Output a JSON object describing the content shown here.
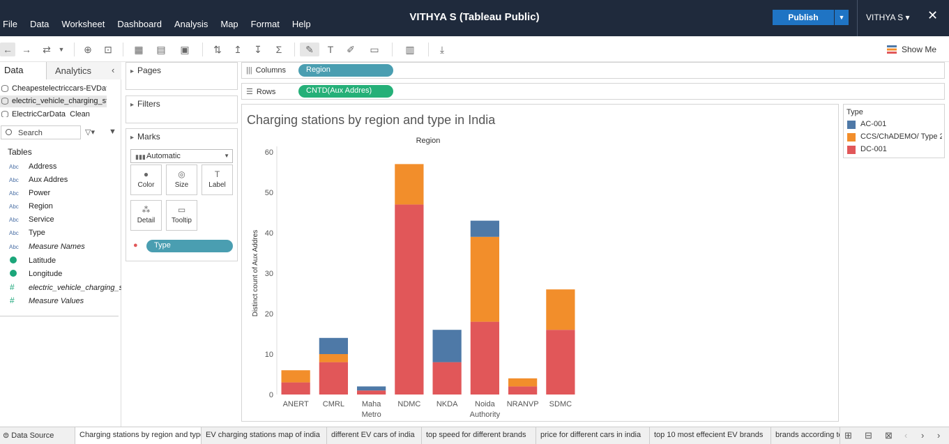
{
  "app": {
    "title": "VITHYA S (Tableau Public)",
    "menu": [
      "File",
      "Data",
      "Worksheet",
      "Dashboard",
      "Analysis",
      "Map",
      "Format",
      "Help"
    ],
    "publish_label": "Publish",
    "user_label": "VITHYA S ▾",
    "close_glyph": "✕"
  },
  "toolbar": {
    "show_me_label": "Show Me"
  },
  "data_pane": {
    "tabs": [
      "Data",
      "Analytics"
    ],
    "datasources": [
      "Cheapestelectriccars-EVDatabase",
      "electric_vehicle_charging_station_list",
      "ElectricCarData_Clean"
    ],
    "search_placeholder": "Search",
    "tables_heading": "Tables",
    "fields": [
      {
        "type": "Abc",
        "name": "Address",
        "italic": false
      },
      {
        "type": "Abc",
        "name": "Aux Addres",
        "italic": false
      },
      {
        "type": "Abc",
        "name": "Power",
        "italic": false
      },
      {
        "type": "Abc",
        "name": "Region",
        "italic": false
      },
      {
        "type": "Abc",
        "name": "Service",
        "italic": false
      },
      {
        "type": "Abc",
        "name": "Type",
        "italic": false
      },
      {
        "type": "Abc",
        "name": "Measure Names",
        "italic": true
      },
      {
        "type": "geo",
        "name": "Latitude",
        "italic": false
      },
      {
        "type": "geo",
        "name": "Longitude",
        "italic": false
      },
      {
        "type": "#",
        "name": "electric_vehicle_charging_station_list (Count)",
        "italic": true
      },
      {
        "type": "#",
        "name": "Measure Values",
        "italic": true
      }
    ]
  },
  "cards": {
    "pages_label": "Pages",
    "filters_label": "Filters",
    "marks_label": "Marks",
    "mark_type": "Automatic",
    "buttons": [
      "Color",
      "Size",
      "Label",
      "Detail",
      "Tooltip"
    ],
    "color_pill": "Type"
  },
  "shelves": {
    "columns_label": "Columns",
    "columns_pill": "Region",
    "rows_label": "Rows",
    "rows_pill": "CNTD(Aux Addres)"
  },
  "chart_data": {
    "type": "bar",
    "title": "Charging stations by region and type in India",
    "header": "Region",
    "ylabel": "Distinct count of Aux Addres",
    "xlabel": "",
    "ylim": [
      0,
      60
    ],
    "yticks": [
      0,
      10,
      20,
      30,
      40,
      50,
      60
    ],
    "categories": [
      "ANERT",
      "CMRL",
      "Maha Metro",
      "NDMC",
      "NKDA",
      "Noida Authority",
      "NRANVP",
      "SDMC"
    ],
    "series": [
      {
        "name": "DC-001",
        "color": "#e15759",
        "values": [
          3,
          8,
          1,
          47,
          8,
          18,
          2,
          16
        ]
      },
      {
        "name": "CCS/ChADEMO/ Type 2",
        "color": "#f28e2b",
        "values": [
          3,
          2,
          0,
          10,
          0,
          21,
          2,
          10
        ]
      },
      {
        "name": "AC-001",
        "color": "#4e79a7",
        "values": [
          0,
          4,
          1,
          0,
          8,
          4,
          0,
          0
        ]
      }
    ]
  },
  "legend": {
    "title": "Type",
    "items": [
      {
        "label": "AC-001",
        "color": "#4e79a7"
      },
      {
        "label": "CCS/ChADEMO/ Type 2",
        "color": "#f28e2b"
      },
      {
        "label": "DC-001",
        "color": "#e15759"
      }
    ]
  },
  "sheet_tabs": {
    "data_source": "Data Source",
    "tabs": [
      "Charging stations by region and type in India",
      "EV charging stations map of india",
      "different EV cars of india",
      "top speed for different brands",
      "price for different cars in india",
      "top 10 most effecient EV brands",
      "brands according to rapid charge"
    ]
  }
}
